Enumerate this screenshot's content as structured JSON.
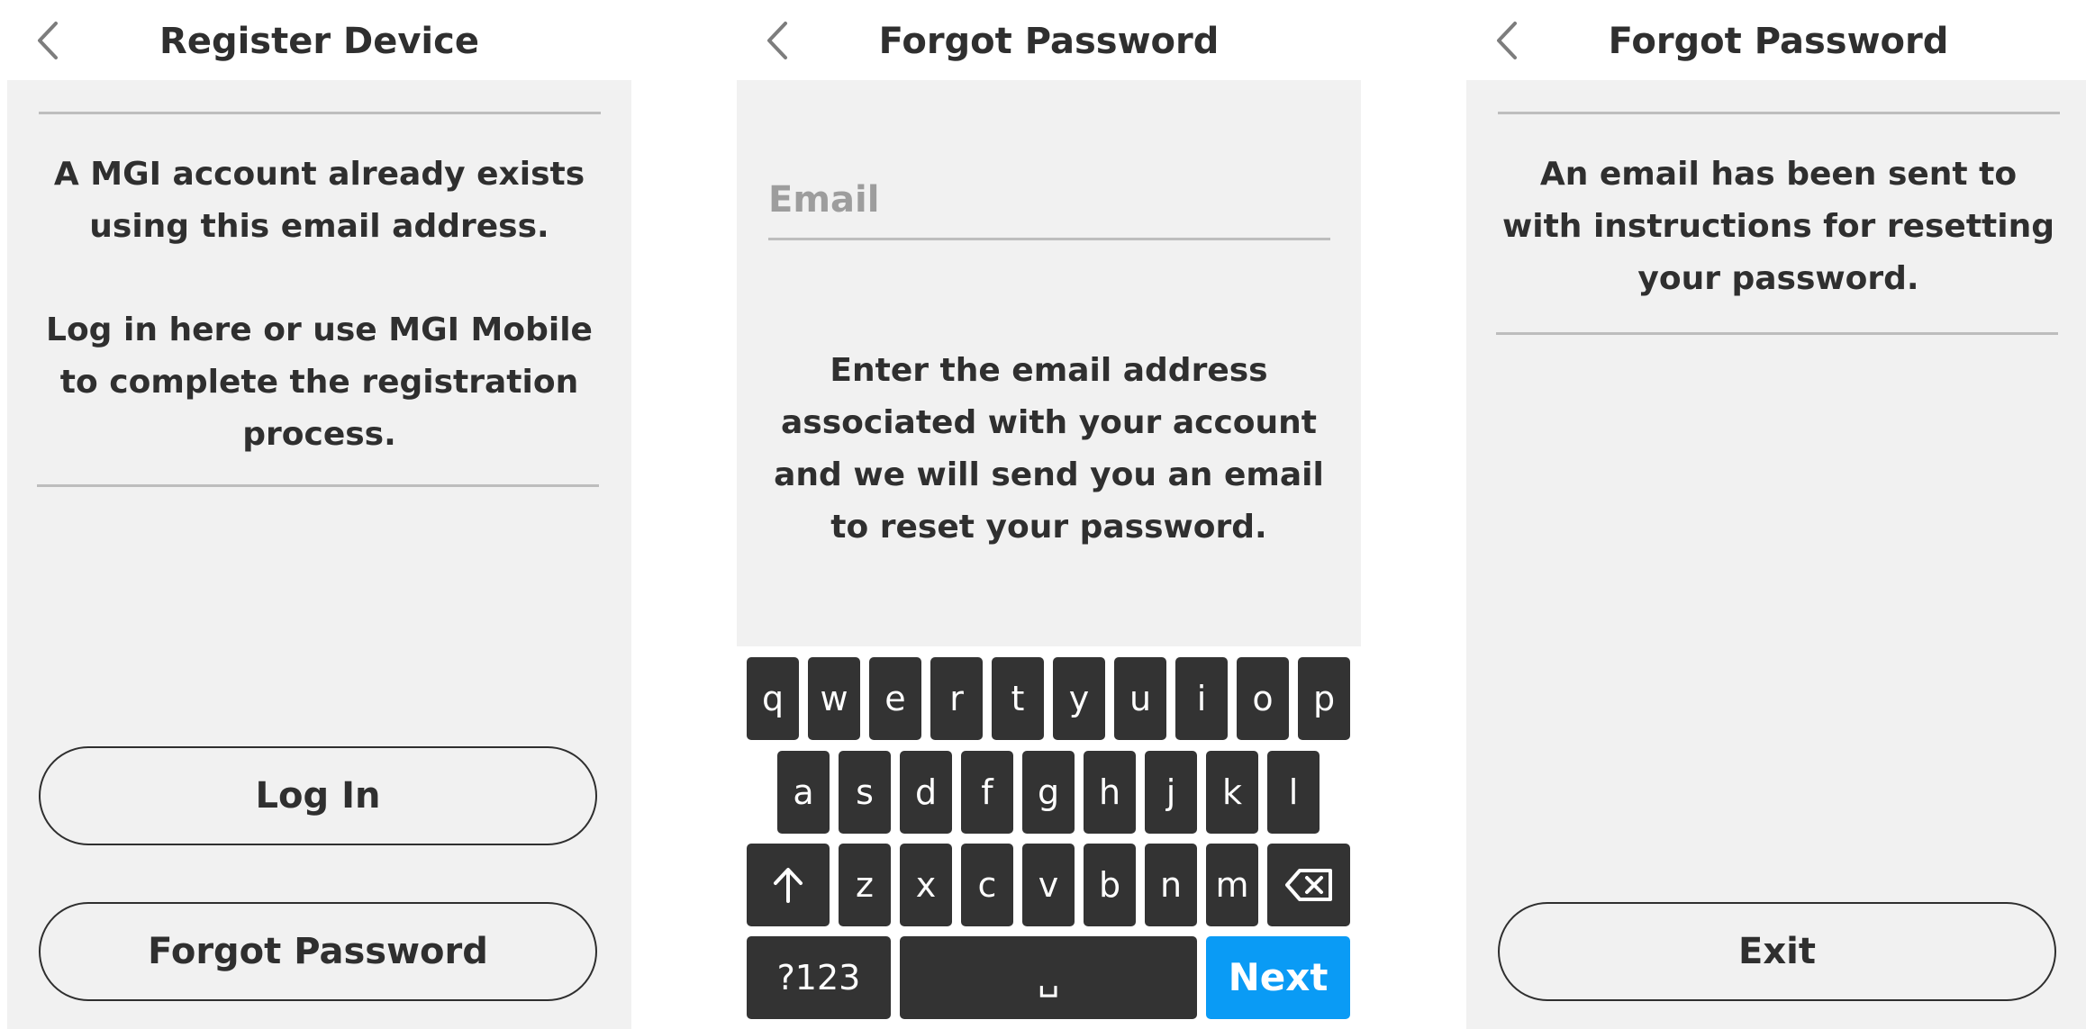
{
  "register": {
    "title": "Register Device",
    "message_line1": "A MGI account already exists\nusing this email address.",
    "message_line2": "Log in here or use MGI Mobile\nto complete the registration\nprocess.",
    "login_label": "Log In",
    "forgot_label": "Forgot Password"
  },
  "forgot": {
    "title": "Forgot Password",
    "email_placeholder": "Email",
    "instructions": "Enter the email address\nassociated with your account\nand we will send you an email\nto reset your password.",
    "keyboard": {
      "row1": [
        "q",
        "w",
        "e",
        "r",
        "t",
        "y",
        "u",
        "i",
        "o",
        "p"
      ],
      "row2": [
        "a",
        "s",
        "d",
        "f",
        "g",
        "h",
        "j",
        "k",
        "l"
      ],
      "row3": [
        "z",
        "x",
        "c",
        "v",
        "b",
        "n",
        "m"
      ],
      "symbols_label": "?123",
      "space_label": "␣",
      "next_label": "Next",
      "next_color": "#0a9bf5"
    }
  },
  "sent": {
    "title": "Forgot Password",
    "message": "An email has been sent to\nwith instructions for resetting\nyour password.",
    "exit_label": "Exit"
  },
  "icons": {
    "back": "chevron-left-icon",
    "shift": "shift-arrow-up-icon",
    "backspace": "backspace-icon"
  }
}
